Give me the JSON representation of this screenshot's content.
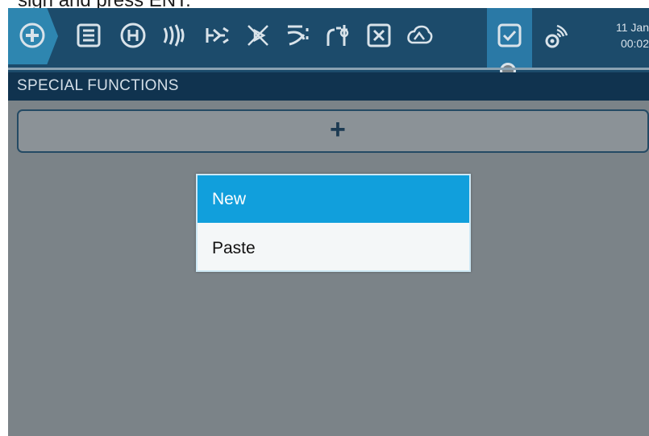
{
  "caption": "sign and press ENT.",
  "toolbar": {
    "icons": [
      {
        "name": "add-model-icon"
      },
      {
        "name": "menu-list-icon"
      },
      {
        "name": "helicopter-icon"
      },
      {
        "name": "sound-icon"
      },
      {
        "name": "mixer-icon"
      },
      {
        "name": "servo-icon"
      },
      {
        "name": "curves-icon"
      },
      {
        "name": "logic-switch-icon"
      },
      {
        "name": "variable-icon"
      },
      {
        "name": "telemetry-icon"
      },
      {
        "name": "special-functions-icon"
      },
      {
        "name": "radio-setup-icon"
      }
    ],
    "date": "11 Jan",
    "time": "00:02",
    "colors": {
      "bar": "#1c4b6b",
      "active": "#2a79a6",
      "icon": "#d9e3ea"
    }
  },
  "page": {
    "title": "SPECIAL FUNCTIONS",
    "add_label": "+"
  },
  "context_menu": {
    "items": [
      "New",
      "Paste"
    ],
    "selected_index": 0,
    "accent": "#119fdc"
  }
}
